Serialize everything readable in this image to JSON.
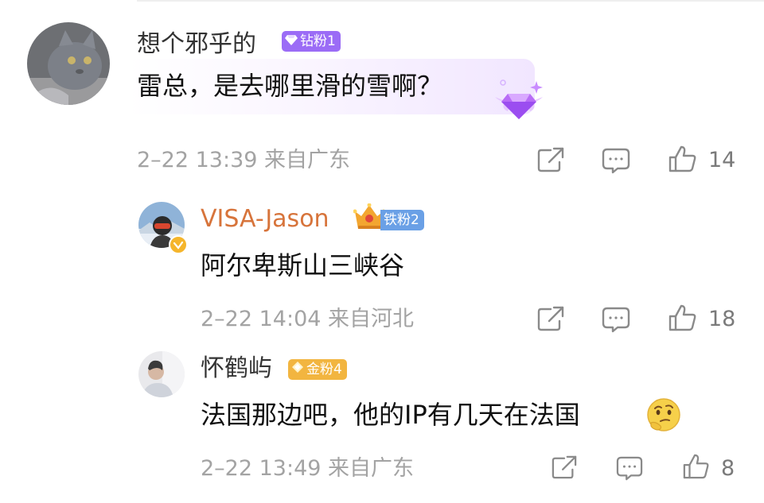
{
  "comments": [
    {
      "username": "想个邪乎的",
      "badge": {
        "label": "钻粉1",
        "color": "#9b6cf6",
        "icon": "diamond-icon"
      },
      "text": "雷总，是去哪里滑的雪啊？",
      "meta": "2–22 13:39 来自广东",
      "likes": "14"
    },
    {
      "username": "VISA-Jason",
      "badge": {
        "label": "铁粉2",
        "color": "#6aa0e6",
        "icon": "crown-icon"
      },
      "text": "阿尔卑斯山三峡谷",
      "meta": "2–22 14:04 来自河北",
      "likes": "18"
    },
    {
      "username": "怀鹤屿",
      "badge": {
        "label": "金粉4",
        "color": "#f2b540",
        "icon": "gold-diamond-icon"
      },
      "text": "法国那边吧，他的IP有几天在法国",
      "emoji": "thinking-face-emoji",
      "meta": "2–22 13:49 来自广东",
      "likes": "8"
    }
  ],
  "colors": {
    "vip_name": "#d7743b",
    "meta": "#a3a3a3",
    "icon": "#8a8a8a"
  }
}
